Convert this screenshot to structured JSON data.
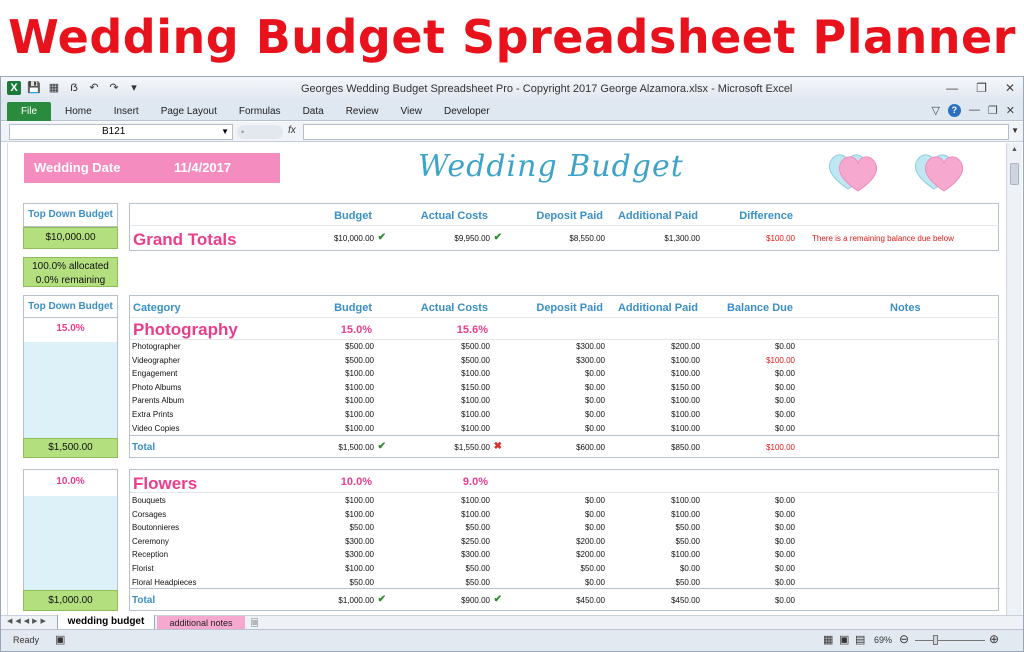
{
  "banner": {
    "title": "Wedding Budget Spreadsheet Planner"
  },
  "window": {
    "title": "Georges Wedding Budget Spreadsheet Pro - Copyright 2017 George Alzamora.xlsx  -  Microsoft Excel",
    "file_tab": "File",
    "tabs": [
      "Home",
      "Insert",
      "Page Layout",
      "Formulas",
      "Data",
      "Review",
      "View",
      "Developer"
    ],
    "name_box": "B121",
    "fx": "fx",
    "status": "Ready",
    "zoom": "69%"
  },
  "sheet": {
    "wedding_date_label": "Wedding Date",
    "wedding_date": "11/4/2017",
    "title": "Wedding Budget",
    "top_down_label": "Top Down Budget",
    "top_down_value": "$10,000.00",
    "allocated": "100.0%  allocated",
    "remaining": "0.0%  remaining",
    "grand": {
      "headers": [
        "Budget",
        "Actual Costs",
        "Deposit Paid",
        "Additional Paid",
        "Difference"
      ],
      "label": "Grand Totals",
      "values": [
        "$10,000.00",
        "$9,950.00",
        "$8,550.00",
        "$1,300.00",
        "$100.00"
      ],
      "note": "There is a remaining balance due below"
    },
    "cat_headers": [
      "Category",
      "Budget",
      "Actual Costs",
      "Deposit Paid",
      "Additional Paid",
      "Balance Due",
      "Notes"
    ],
    "total_label": "Total",
    "sections": [
      {
        "name": "Photography",
        "left_pct": "15.0%",
        "left_total": "$1,500.00",
        "budget_pct": "15.0%",
        "actual_pct": "15.6%",
        "rows": [
          [
            "Photographer",
            "$500.00",
            "$500.00",
            "$300.00",
            "$200.00",
            "$0.00"
          ],
          [
            "Videographer",
            "$500.00",
            "$500.00",
            "$300.00",
            "$100.00",
            "$100.00"
          ],
          [
            "Engagement",
            "$100.00",
            "$100.00",
            "$0.00",
            "$100.00",
            "$0.00"
          ],
          [
            "Photo Albums",
            "$100.00",
            "$150.00",
            "$0.00",
            "$150.00",
            "$0.00"
          ],
          [
            "Parents Album",
            "$100.00",
            "$100.00",
            "$0.00",
            "$100.00",
            "$0.00"
          ],
          [
            "Extra Prints",
            "$100.00",
            "$100.00",
            "$0.00",
            "$100.00",
            "$0.00"
          ],
          [
            "Video Copies",
            "$100.00",
            "$100.00",
            "$0.00",
            "$100.00",
            "$0.00"
          ]
        ],
        "totals": [
          "$1,500.00",
          "$1,550.00",
          "$600.00",
          "$850.00",
          "$100.00"
        ]
      },
      {
        "name": "Flowers",
        "left_pct": "10.0%",
        "left_total": "$1,000.00",
        "budget_pct": "10.0%",
        "actual_pct": "9.0%",
        "rows": [
          [
            "Bouquets",
            "$100.00",
            "$100.00",
            "$0.00",
            "$100.00",
            "$0.00"
          ],
          [
            "Corsages",
            "$100.00",
            "$100.00",
            "$0.00",
            "$100.00",
            "$0.00"
          ],
          [
            "Boutonnieres",
            "$50.00",
            "$50.00",
            "$0.00",
            "$50.00",
            "$0.00"
          ],
          [
            "Ceremony",
            "$300.00",
            "$250.00",
            "$200.00",
            "$50.00",
            "$0.00"
          ],
          [
            "Reception",
            "$300.00",
            "$300.00",
            "$200.00",
            "$100.00",
            "$0.00"
          ],
          [
            "Florist",
            "$100.00",
            "$50.00",
            "$50.00",
            "$0.00",
            "$0.00"
          ],
          [
            "Floral Headpieces",
            "$50.00",
            "$50.00",
            "$0.00",
            "$50.00",
            "$0.00"
          ]
        ],
        "totals": [
          "$1,000.00",
          "$900.00",
          "$450.00",
          "$450.00",
          "$0.00"
        ]
      }
    ],
    "sheet_tabs": [
      "wedding budget",
      "additional notes"
    ]
  }
}
